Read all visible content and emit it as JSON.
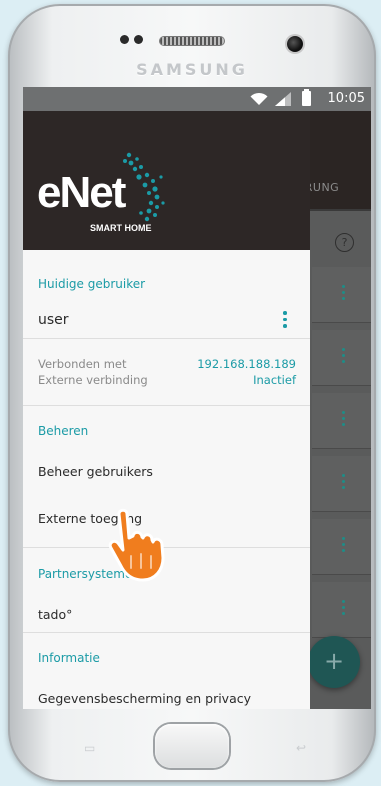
{
  "device": {
    "brand": "SAMSUNG"
  },
  "status_bar": {
    "time": "10:05"
  },
  "background_app": {
    "tab_label": "AUTOMATISIERUNG",
    "fab_label": "+"
  },
  "drawer": {
    "logo": {
      "name": "eNet",
      "tagline": "SMART HOME"
    },
    "current_user": {
      "section_title": "Huidige gebruiker",
      "username": "user"
    },
    "connection": {
      "connected_label": "Verbonden met",
      "connected_value": "192.168.188.189",
      "external_label": "Externe verbinding",
      "external_value": "Inactief"
    },
    "manage": {
      "section_title": "Beheren",
      "items": [
        "Beheer gebruikers",
        "Externe toegang"
      ]
    },
    "partners": {
      "section_title": "Partnersystemen",
      "items": [
        "tado°"
      ]
    },
    "info": {
      "section_title": "Informatie",
      "items": [
        "Gegevensbescherming en privacy"
      ]
    }
  },
  "colors": {
    "accent": "#1b9ba6",
    "header_bg": "#2d2726",
    "fab": "#1f5654",
    "pointer_hand": "#f07d1e"
  }
}
